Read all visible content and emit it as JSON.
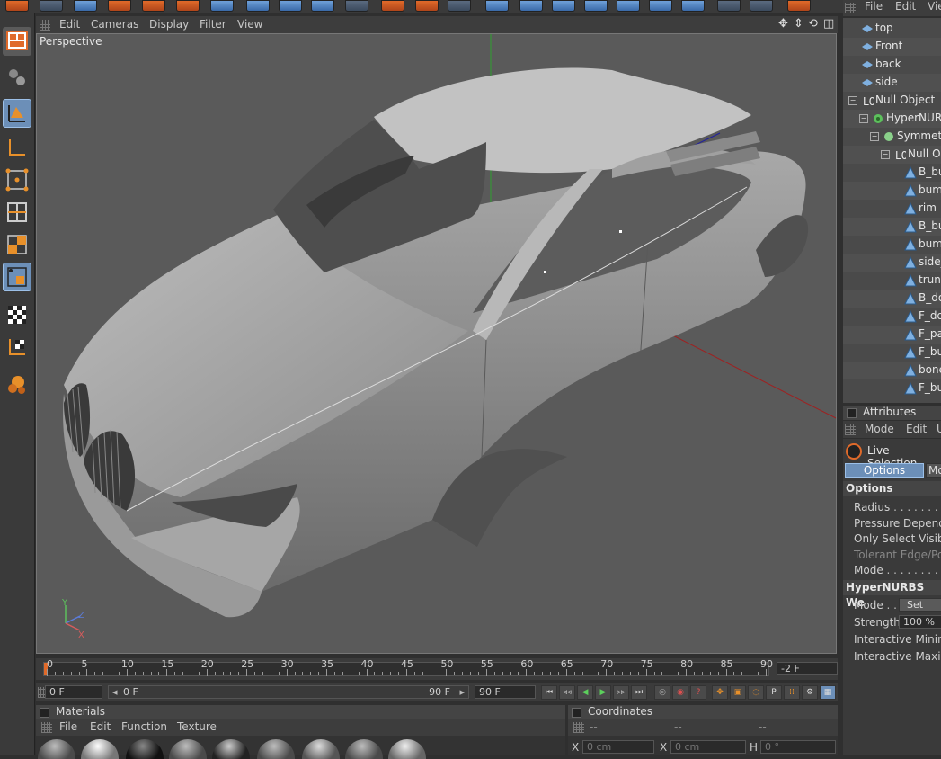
{
  "viewport": {
    "menu": [
      "Edit",
      "Cameras",
      "Display",
      "Filter",
      "View"
    ],
    "label": "Perspective",
    "axes": {
      "y": "Y",
      "z": "Z",
      "x": "X"
    }
  },
  "object_manager": {
    "menu": [
      "File",
      "Edit",
      "Vie"
    ],
    "items": [
      {
        "label": "top",
        "indent": 1,
        "icon": "camera-icon"
      },
      {
        "label": "Front",
        "indent": 1,
        "icon": "camera-icon"
      },
      {
        "label": "back",
        "indent": 1,
        "icon": "camera-icon"
      },
      {
        "label": "side",
        "indent": 1,
        "icon": "camera-icon"
      },
      {
        "label": "Null Object",
        "indent": 0,
        "icon": "null-object-icon"
      },
      {
        "label": "HyperNURB",
        "indent": 1,
        "icon": "hypernurbs-icon"
      },
      {
        "label": "Symmetr",
        "indent": 2,
        "icon": "symmetry-icon"
      },
      {
        "label": "Null Ob",
        "indent": 3,
        "icon": "null-object-icon"
      },
      {
        "label": "B_bu",
        "indent": 4,
        "icon": "polygon-icon"
      },
      {
        "label": "bump",
        "indent": 4,
        "icon": "polygon-icon"
      },
      {
        "label": "rim",
        "indent": 4,
        "icon": "polygon-icon"
      },
      {
        "label": "B_bu",
        "indent": 4,
        "icon": "polygon-icon"
      },
      {
        "label": "bump",
        "indent": 4,
        "icon": "polygon-icon"
      },
      {
        "label": "side_",
        "indent": 4,
        "icon": "polygon-icon"
      },
      {
        "label": "trunk",
        "indent": 4,
        "icon": "polygon-icon"
      },
      {
        "label": "B_do",
        "indent": 4,
        "icon": "polygon-icon"
      },
      {
        "label": "F_do",
        "indent": 4,
        "icon": "polygon-icon"
      },
      {
        "label": "F_par",
        "indent": 4,
        "icon": "polygon-icon"
      },
      {
        "label": "F_bu",
        "indent": 4,
        "icon": "polygon-icon"
      },
      {
        "label": "bone",
        "indent": 4,
        "icon": "polygon-icon"
      },
      {
        "label": "F_bu",
        "indent": 4,
        "icon": "polygon-icon"
      }
    ]
  },
  "attributes": {
    "title": "Attributes",
    "menu": [
      "Mode",
      "Edit",
      "U"
    ],
    "tool_name": "Live Selection",
    "tabs": [
      "Options",
      "Mo"
    ],
    "options_header": "Options",
    "rows": [
      {
        "label": "Radius",
        "dots": " . . . . . . . . . ."
      },
      {
        "label": "Pressure Depend",
        "dots": ""
      },
      {
        "label": "Only Select Visib",
        "dots": ""
      },
      {
        "label": "Tolerant Edge/Po",
        "dots": ""
      },
      {
        "label": "Mode",
        "dots": " . . . . . . . . . . ."
      }
    ],
    "hyper_header": "HyperNURBS We",
    "mode_label": "Mode",
    "mode_dots": " . .",
    "mode_value": "Set",
    "strength_label": "Strength",
    "strength_value": "100 %",
    "interactive_min": "Interactive Minim",
    "interactive_max": "Interactive Maxim"
  },
  "timeline": {
    "ticks": [
      "0",
      "5",
      "10",
      "15",
      "20",
      "25",
      "30",
      "35",
      "40",
      "45",
      "50",
      "55",
      "60",
      "65",
      "70",
      "75",
      "80",
      "85",
      "90"
    ],
    "current_frame": "-2 F"
  },
  "transport": {
    "start": "0 F",
    "range_start": "0 F",
    "range_end": "90 F",
    "end": "90 F"
  },
  "materials": {
    "title": "Materials",
    "menu": [
      "File",
      "Edit",
      "Function",
      "Texture"
    ]
  },
  "coordinates": {
    "title": "Coordinates",
    "headers": [
      "--",
      "--",
      "--"
    ],
    "x_label": "X",
    "x_value": "0 cm",
    "x2_label": "X",
    "x2_value": "0 cm",
    "h_label": "H",
    "h_value": "0 °"
  },
  "colors": {
    "active_tool": "#6c8fb8",
    "viewport_bg": "#5a5a5a",
    "accent_orange": "#e06a2a"
  }
}
